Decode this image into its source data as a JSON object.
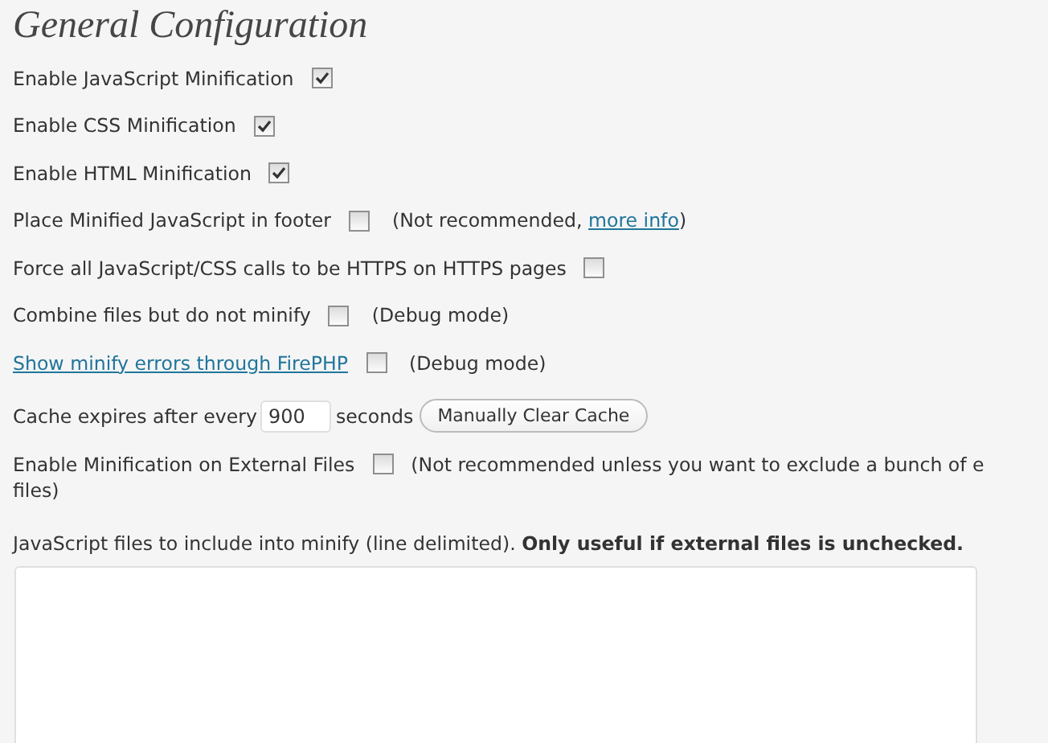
{
  "title": "General Configuration",
  "rows": [
    {
      "kind": "checkbox",
      "label": "Enable JavaScript Minification",
      "link": false,
      "checked": true
    },
    {
      "kind": "checkbox",
      "label": "Enable CSS Minification",
      "link": false,
      "checked": true
    },
    {
      "kind": "checkbox",
      "label": "Enable HTML Minification",
      "link": false,
      "checked": true
    },
    {
      "kind": "checkbox",
      "label": "Place Minified JavaScript in footer",
      "link": false,
      "checked": false,
      "note": "(Not recommended, ",
      "note_link": "more info",
      "note_end": ")"
    },
    {
      "kind": "checkbox",
      "label": "Force all JavaScript/CSS calls to be HTTPS on HTTPS pages",
      "link": false,
      "checked": false
    },
    {
      "kind": "checkbox",
      "label": "Combine files but do not minify",
      "link": false,
      "checked": false,
      "note": "(Debug mode)"
    },
    {
      "kind": "checkbox",
      "label": "Show minify errors through FirePHP",
      "link": true,
      "checked": false,
      "note": "(Debug mode)"
    },
    {
      "kind": "cache",
      "label": "Cache expires after every",
      "value": "900",
      "unit": "seconds",
      "button": "Manually Clear Cache"
    },
    {
      "kind": "checkbox",
      "label": "Enable Minification on External Files",
      "link": false,
      "checked": false,
      "note": "(Not recommended unless you want to exclude a bunch of e",
      "note_continued": "files)"
    }
  ],
  "textarea_label": "JavaScript files to include into minify (line delimited). **Only useful if external files is unchecked.**"
}
